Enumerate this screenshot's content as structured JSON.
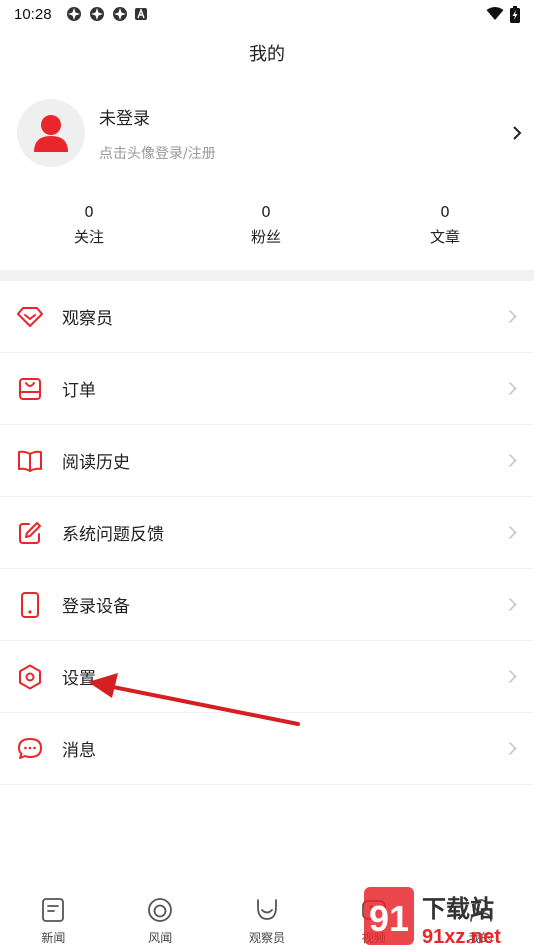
{
  "status_bar": {
    "time": "10:28"
  },
  "header": {
    "title": "我的"
  },
  "profile": {
    "name": "未登录",
    "hint": "点击头像登录/注册"
  },
  "stats": [
    {
      "value": "0",
      "label": "关注"
    },
    {
      "value": "0",
      "label": "粉丝"
    },
    {
      "value": "0",
      "label": "文章"
    }
  ],
  "menu": [
    {
      "label": "观察员",
      "icon": "diamond-icon"
    },
    {
      "label": "订单",
      "icon": "bag-icon"
    },
    {
      "label": "阅读历史",
      "icon": "book-icon"
    },
    {
      "label": "系统问题反馈",
      "icon": "edit-icon"
    },
    {
      "label": "登录设备",
      "icon": "phone-icon"
    },
    {
      "label": "设置",
      "icon": "hexagon-settings-icon"
    },
    {
      "label": "消息",
      "icon": "chat-icon"
    }
  ],
  "bottom_nav": [
    {
      "label": "新闻",
      "icon": "news-icon"
    },
    {
      "label": "风闻",
      "icon": "ring-icon"
    },
    {
      "label": "观察员",
      "icon": "observer-icon"
    },
    {
      "label": "视频",
      "icon": "video-icon"
    },
    {
      "label": "我的",
      "icon": "profile-icon"
    }
  ],
  "watermark": {
    "text_top": "下载站",
    "text_bottom": "91xz.net"
  },
  "colors": {
    "accent": "#e8262b",
    "text": "#222222",
    "muted": "#999999",
    "divider": "#f2f2f2"
  }
}
